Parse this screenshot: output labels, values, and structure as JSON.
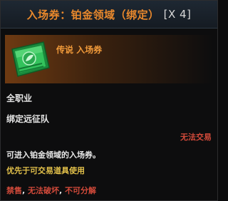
{
  "header": {
    "title": "入场券：铂金领域（绑定）",
    "count": "[X 4]"
  },
  "item": {
    "icon": "ticket-icon",
    "rarity_label": "传说 入场券"
  },
  "details": {
    "class_restriction": "全职业",
    "binding": "绑定远征队",
    "trade_status": "无法交易",
    "description": "可进入铂金领域的入场券。",
    "usage_note": "优先于可交易道具使用",
    "flags": [
      "禁售",
      "无法破坏",
      "不可分解"
    ],
    "flag_separator": ", "
  },
  "colors": {
    "title": "#e8882c",
    "rarity": "#f09a3a",
    "warning": "#d24a3a",
    "note": "#e2c04a"
  }
}
